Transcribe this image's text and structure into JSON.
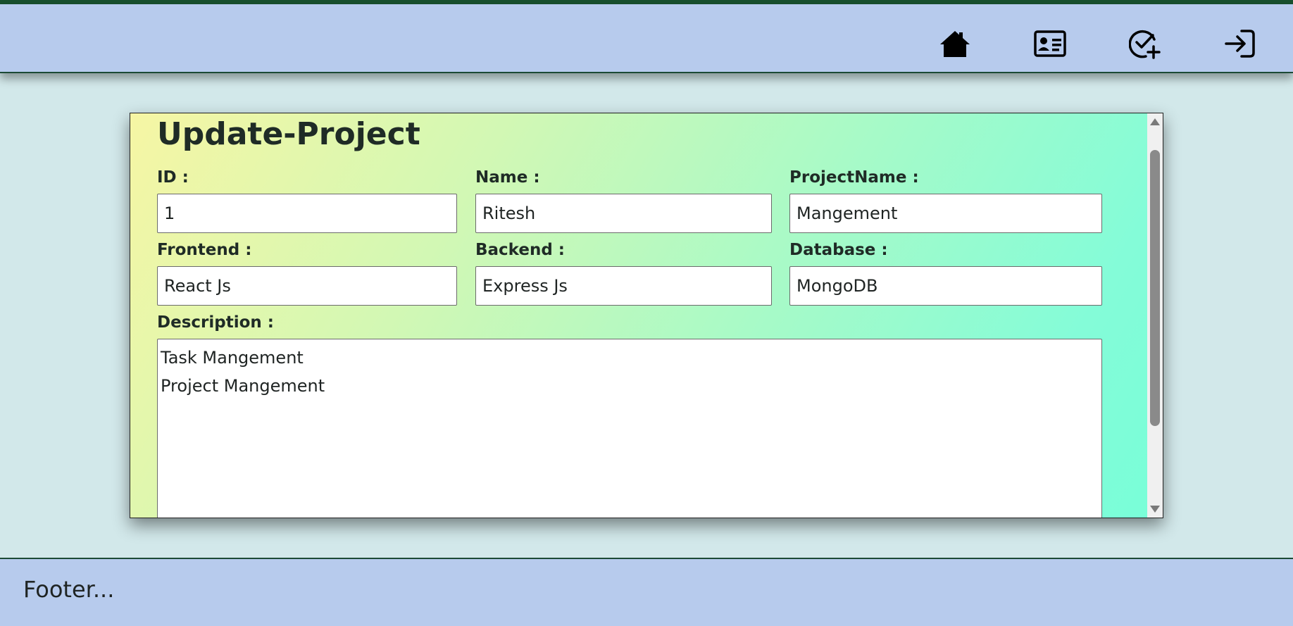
{
  "nav": {
    "icons": [
      "home-icon",
      "contact-card-icon",
      "check-plus-icon",
      "login-arrow-icon"
    ]
  },
  "form": {
    "title": "Update-Project",
    "id_label": "ID :",
    "id_value": "1",
    "name_label": "Name :",
    "name_value": "Ritesh",
    "project_label": "ProjectName :",
    "project_value": "Mangement",
    "frontend_label": "Frontend :",
    "frontend_value": "React Js",
    "backend_label": "Backend :",
    "backend_value": "Express Js",
    "database_label": "Database :",
    "database_value": "MongoDB",
    "description_label": "Description :",
    "description_value": "Task Mangement\nProject Mangement"
  },
  "footer": {
    "text": "Footer..."
  },
  "colors": {
    "header_bg": "#b7cbed",
    "page_bg": "#d2e8ea",
    "accent_dark_green": "#18502e"
  }
}
